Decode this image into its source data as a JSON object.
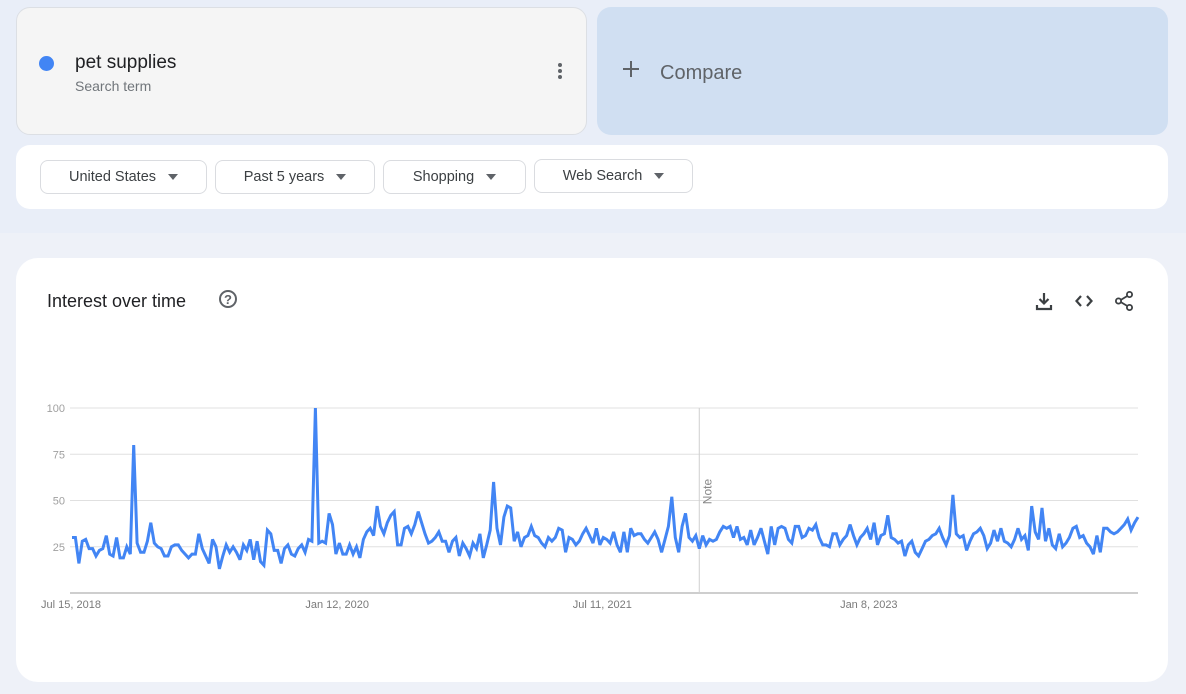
{
  "search_term": {
    "label": "pet supplies",
    "sublabel": "Search term",
    "color": "#4285f4"
  },
  "compare": {
    "label": "Compare"
  },
  "filters": [
    {
      "label": "United States"
    },
    {
      "label": "Past 5 years"
    },
    {
      "label": "Shopping"
    },
    {
      "label": "Web Search"
    }
  ],
  "card": {
    "title": "Interest over time",
    "help_icon": "help-circle-icon",
    "actions": [
      "download-icon",
      "embed-code-icon",
      "share-icon"
    ]
  },
  "chart_data": {
    "type": "line",
    "title": "Interest over time",
    "xlabel": "",
    "ylabel": "",
    "ylim": [
      0,
      100
    ],
    "yticks": [
      25,
      50,
      75,
      100
    ],
    "grid": true,
    "x_tick_labels": [
      {
        "label": "Jul 15, 2018",
        "index": 0
      },
      {
        "label": "Jan 12, 2020",
        "index": 78
      },
      {
        "label": "Jul 11, 2021",
        "index": 156
      },
      {
        "label": "Jan 8, 2023",
        "index": 234
      }
    ],
    "annotation": {
      "label": "Note",
      "index": 183
    },
    "series": [
      {
        "name": "pet supplies",
        "color": "#4285f4",
        "values": [
          30,
          30,
          16,
          28,
          29,
          24,
          24,
          20,
          23,
          24,
          31,
          21,
          20,
          30,
          19,
          19,
          25,
          21,
          80,
          27,
          22,
          22,
          28,
          38,
          27,
          25,
          24,
          20,
          20,
          25,
          26,
          26,
          23,
          21,
          19,
          21,
          21,
          32,
          24,
          20,
          16,
          29,
          25,
          13,
          20,
          26,
          22,
          25,
          22,
          18,
          26,
          23,
          29,
          18,
          28,
          17,
          15,
          34,
          32,
          23,
          23,
          16,
          24,
          26,
          21,
          20,
          24,
          26,
          22,
          29,
          28,
          100,
          27,
          28,
          27,
          43,
          37,
          21,
          27,
          21,
          21,
          26,
          21,
          25,
          19,
          29,
          33,
          35,
          31,
          47,
          36,
          32,
          38,
          42,
          44,
          26,
          26,
          35,
          36,
          32,
          37,
          44,
          38,
          32,
          27,
          28,
          30,
          33,
          28,
          28,
          22,
          28,
          30,
          20,
          27,
          24,
          20,
          27,
          24,
          32,
          19,
          26,
          34,
          60,
          35,
          26,
          41,
          47,
          46,
          28,
          33,
          25,
          30,
          31,
          36,
          31,
          30,
          27,
          25,
          30,
          28,
          30,
          35,
          34,
          22,
          30,
          29,
          26,
          28,
          32,
          35,
          31,
          27,
          35,
          26,
          30,
          29,
          27,
          33,
          26,
          22,
          33,
          22,
          35,
          31,
          32,
          32,
          29,
          27,
          30,
          33,
          29,
          22,
          29,
          36,
          52,
          30,
          22,
          36,
          43,
          30,
          28,
          31,
          24,
          31,
          26,
          29,
          28,
          29,
          33,
          36,
          35,
          36,
          30,
          36,
          29,
          30,
          26,
          34,
          26,
          30,
          35,
          28,
          21,
          36,
          26,
          35,
          36,
          35,
          29,
          27,
          36,
          36,
          30,
          31,
          35,
          34,
          37,
          30,
          26,
          26,
          25,
          32,
          32,
          26,
          29,
          31,
          37,
          31,
          26,
          30,
          32,
          35,
          29,
          38,
          26,
          31,
          32,
          42,
          30,
          29,
          27,
          28,
          20,
          26,
          28,
          22,
          20,
          24,
          28,
          29,
          31,
          32,
          35,
          30,
          26,
          31,
          53,
          32,
          30,
          31,
          23,
          28,
          32,
          33,
          35,
          31,
          24,
          27,
          34,
          28,
          35,
          28,
          27,
          25,
          29,
          35,
          29,
          31,
          23,
          47,
          33,
          29,
          46,
          28,
          35,
          26,
          24,
          32,
          25,
          27,
          30,
          35,
          36,
          30,
          31,
          27,
          25,
          21,
          31,
          22,
          35,
          35,
          33,
          32,
          33,
          35,
          37,
          40,
          34,
          38,
          41
        ]
      }
    ]
  }
}
